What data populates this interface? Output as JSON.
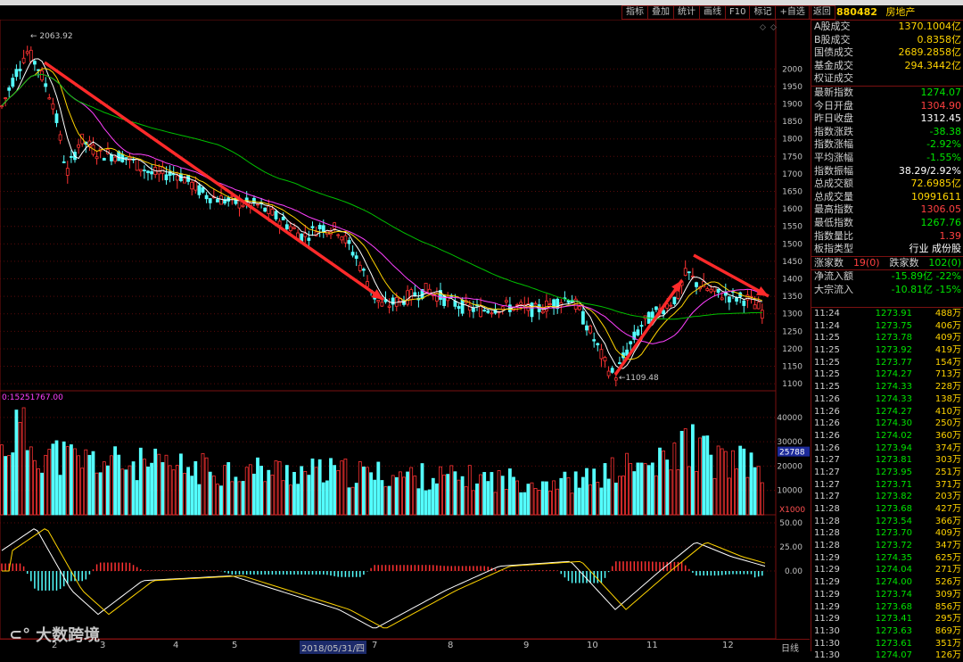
{
  "toolbar": [
    "指标",
    "叠加",
    "统计",
    "画线",
    "F10",
    "标记",
    "+自选",
    "返回"
  ],
  "header": {
    "code": "880482",
    "name": "房地产"
  },
  "stats_top": [
    {
      "k": "A股成交",
      "v": "1370.1004亿",
      "c": "yellow"
    },
    {
      "k": "B股成交",
      "v": "0.8358亿",
      "c": "yellow"
    },
    {
      "k": "国债成交",
      "v": "2689.2858亿",
      "c": "yellow"
    },
    {
      "k": "基金成交",
      "v": "294.3442亿",
      "c": "yellow"
    },
    {
      "k": "权证成交",
      "v": "",
      "c": "yellow"
    }
  ],
  "stats_mid": [
    {
      "k": "最新指数",
      "v": "1274.07",
      "c": "green"
    },
    {
      "k": "今日开盘",
      "v": "1304.90",
      "c": "red"
    },
    {
      "k": "昨日收盘",
      "v": "1312.45",
      "c": "white"
    },
    {
      "k": "指数涨跌",
      "v": "-38.38",
      "c": "green"
    },
    {
      "k": "指数涨幅",
      "v": "-2.92%",
      "c": "green"
    },
    {
      "k": "平均涨幅",
      "v": "-1.55%",
      "c": "green"
    },
    {
      "k": "指数振幅",
      "v": "38.29/2.92%",
      "c": "white"
    },
    {
      "k": "总成交额",
      "v": "72.6985亿",
      "c": "yellow"
    },
    {
      "k": "总成交量",
      "v": "10991611",
      "c": "yellow"
    },
    {
      "k": "最高指数",
      "v": "1306.05",
      "c": "red"
    },
    {
      "k": "最低指数",
      "v": "1267.76",
      "c": "green"
    },
    {
      "k": "指数量比",
      "v": "1.39",
      "c": "red"
    },
    {
      "k": "板指类型",
      "v": "行业 成份股",
      "c": "white"
    }
  ],
  "updown": {
    "up_label": "涨家数",
    "up_val": "19(0)",
    "down_label": "跌家数",
    "down_val": "102(0)"
  },
  "flows": [
    {
      "k": "净流入额",
      "v": "-15.89亿 -22%"
    },
    {
      "k": "大宗流入",
      "v": "-10.81亿 -15%"
    }
  ],
  "ticks": [
    [
      "11:24",
      "1273.91",
      "488万"
    ],
    [
      "11:24",
      "1273.75",
      "406万"
    ],
    [
      "11:25",
      "1273.78",
      "409万"
    ],
    [
      "11:25",
      "1273.92",
      "419万"
    ],
    [
      "11:25",
      "1273.77",
      "154万"
    ],
    [
      "11:25",
      "1274.27",
      "713万"
    ],
    [
      "11:25",
      "1274.33",
      "228万"
    ],
    [
      "11:26",
      "1274.33",
      "138万"
    ],
    [
      "11:26",
      "1274.27",
      "410万"
    ],
    [
      "11:26",
      "1274.30",
      "250万"
    ],
    [
      "11:26",
      "1274.02",
      "360万"
    ],
    [
      "11:26",
      "1273.94",
      "374万"
    ],
    [
      "11:27",
      "1273.81",
      "303万"
    ],
    [
      "11:27",
      "1273.95",
      "251万"
    ],
    [
      "11:27",
      "1273.71",
      "371万"
    ],
    [
      "11:27",
      "1273.82",
      "203万"
    ],
    [
      "11:28",
      "1273.68",
      "427万"
    ],
    [
      "11:28",
      "1273.54",
      "366万"
    ],
    [
      "11:28",
      "1273.70",
      "409万"
    ],
    [
      "11:28",
      "1273.72",
      "347万"
    ],
    [
      "11:29",
      "1274.35",
      "625万"
    ],
    [
      "11:29",
      "1274.04",
      "271万"
    ],
    [
      "11:29",
      "1274.00",
      "526万"
    ],
    [
      "11:29",
      "1273.74",
      "309万"
    ],
    [
      "11:29",
      "1273.68",
      "856万"
    ],
    [
      "11:29",
      "1273.41",
      "295万"
    ],
    [
      "11:30",
      "1273.63",
      "869万"
    ],
    [
      "11:30",
      "1273.61",
      "351万"
    ],
    [
      "11:30",
      "1274.07",
      "126万"
    ]
  ],
  "chart_data": {
    "type": "candlestick",
    "price_axis": [
      2000,
      1950,
      1900,
      1850,
      1800,
      1750,
      1700,
      1650,
      1600,
      1550,
      1500,
      1450,
      1400,
      1350,
      1300,
      1250,
      1200,
      1150,
      1100
    ],
    "high_label": "2063.92",
    "low_label": "1109.48",
    "volume_label": "15251767.00",
    "volume_axis": [
      40000,
      30000,
      20000,
      10000
    ],
    "volume_current": "25788",
    "volume_unit": "X1000",
    "macd_axis": [
      "50.00",
      "25.00",
      "0.00"
    ],
    "x_labels": [
      "2",
      "3",
      "4",
      "5",
      "2018/05/31/四",
      "7",
      "8",
      "9",
      "10",
      "11",
      "12"
    ],
    "period": "日线"
  },
  "watermark": "大数跨境"
}
